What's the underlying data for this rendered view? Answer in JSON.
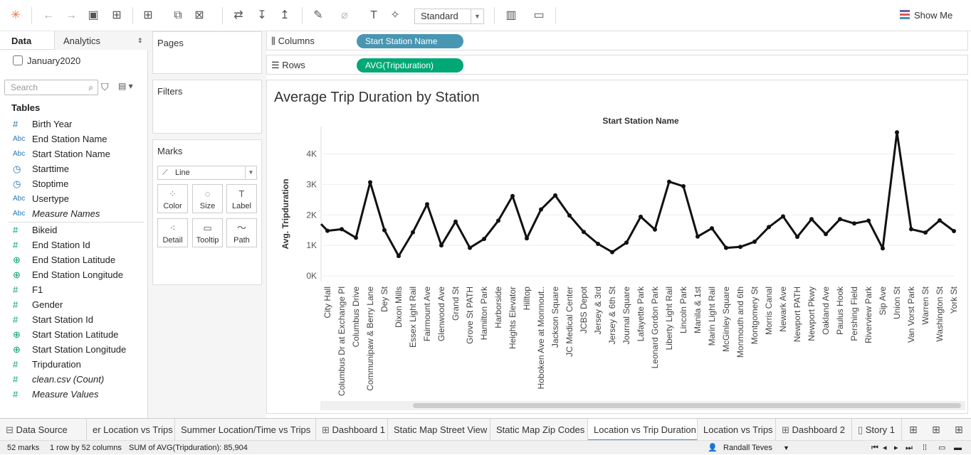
{
  "toolbar": {
    "view_mode": "Standard",
    "show_me": "Show Me"
  },
  "data_pane": {
    "tab_data": "Data",
    "tab_analytics": "Analytics",
    "datasource": "January2020",
    "search_placeholder": "Search",
    "tables_heading": "Tables",
    "fields": [
      {
        "icon": "#",
        "name": "Birth Year",
        "italic": false
      },
      {
        "icon": "Abc",
        "name": "End Station Name",
        "italic": false
      },
      {
        "icon": "Abc",
        "name": "Start Station Name",
        "italic": false
      },
      {
        "icon": "clock",
        "name": "Starttime",
        "italic": false
      },
      {
        "icon": "clock",
        "name": "Stoptime",
        "italic": false
      },
      {
        "icon": "Abc",
        "name": "Usertype",
        "italic": false
      },
      {
        "icon": "Abc",
        "name": "Measure Names",
        "italic": true
      },
      {
        "icon": "#",
        "name": "Bikeid",
        "italic": false
      },
      {
        "icon": "#",
        "name": "End Station Id",
        "italic": false
      },
      {
        "icon": "globe",
        "name": "End Station Latitude",
        "italic": false
      },
      {
        "icon": "globe",
        "name": "End Station Longitude",
        "italic": false
      },
      {
        "icon": "#",
        "name": "F1",
        "italic": false
      },
      {
        "icon": "#",
        "name": "Gender",
        "italic": false
      },
      {
        "icon": "#",
        "name": "Start Station Id",
        "italic": false
      },
      {
        "icon": "globe",
        "name": "Start Station Latitude",
        "italic": false
      },
      {
        "icon": "globe",
        "name": "Start Station Longitude",
        "italic": false
      },
      {
        "icon": "#",
        "name": "Tripduration",
        "italic": false
      },
      {
        "icon": "#",
        "name": "clean.csv (Count)",
        "italic": true
      },
      {
        "icon": "#",
        "name": "Measure Values",
        "italic": true
      }
    ]
  },
  "cards": {
    "pages": "Pages",
    "filters": "Filters",
    "marks": "Marks",
    "mark_type": "Line",
    "buttons": [
      "Color",
      "Size",
      "Label",
      "Detail",
      "Tooltip",
      "Path"
    ]
  },
  "shelves": {
    "columns_label": "Columns",
    "columns_pill": "Start Station Name",
    "rows_label": "Rows",
    "rows_pill": "AVG(Tripduration)"
  },
  "viz": {
    "title": "Average Trip Duration by Station",
    "header": "Start Station Name"
  },
  "chart_data": {
    "type": "line",
    "title": "Average Trip Duration by Station",
    "xlabel": "Start Station Name",
    "ylabel": "Avg. Tripduration",
    "y_ticks": [
      "0K",
      "1K",
      "2K",
      "3K",
      "4K"
    ],
    "ylim": [
      0,
      4900
    ],
    "grid": true,
    "categories": [
      "City Hall",
      "Columbus Dr at Exchange Pl",
      "Columbus Drive",
      "Communipaw & Berry Lane",
      "Dey St",
      "Dixon Mills",
      "Essex Light Rail",
      "Fairmount Ave",
      "Glenwood Ave",
      "Grand St",
      "Grove St PATH",
      "Hamilton Park",
      "Harborside",
      "Heights Elevator",
      "Hilltop",
      "Hoboken Ave at Monmout..",
      "Jackson Square",
      "JC Medical Center",
      "JCBS Depot",
      "Jersey & 3rd",
      "Jersey & 6th St",
      "Journal Square",
      "Lafayette Park",
      "Leonard Gordon Park",
      "Liberty Light Rail",
      "Lincoln Park",
      "Manila & 1st",
      "Marin Light Rail",
      "McGinley Square",
      "Monmouth and 6th",
      "Montgomery St",
      "Morris Canal",
      "Newark Ave",
      "Newport PATH",
      "Newport Pkwy",
      "Oakland Ave",
      "Paulus Hook",
      "Pershing Field",
      "Riverview Park",
      "Sip Ave",
      "Union St",
      "Van Vorst Park",
      "Warren St",
      "Washington St",
      "York St"
    ],
    "values": [
      1480,
      1530,
      1250,
      3070,
      1500,
      650,
      1430,
      2350,
      1000,
      1780,
      920,
      1210,
      1810,
      2620,
      1230,
      2180,
      2640,
      1980,
      1440,
      1050,
      780,
      1090,
      1940,
      1520,
      3090,
      2940,
      1290,
      1560,
      920,
      950,
      1120,
      1600,
      1950,
      1280,
      1860,
      1370,
      1860,
      1720,
      1810,
      900,
      4710,
      1530,
      1420,
      1820,
      1470
    ],
    "leading_value": 1700
  },
  "sheet_tabs": [
    {
      "label": "Data Source",
      "icon": "db"
    },
    {
      "label": "er Location vs Trips",
      "icon": ""
    },
    {
      "label": "Summer Location/Time vs Trips",
      "icon": ""
    },
    {
      "label": "Dashboard 1",
      "icon": "grid"
    },
    {
      "label": "Static Map Street View",
      "icon": ""
    },
    {
      "label": "Static Map Zip Codes",
      "icon": ""
    },
    {
      "label": "Location vs Trip Duration",
      "icon": ""
    },
    {
      "label": "Location vs Trips",
      "icon": ""
    },
    {
      "label": "Dashboard 2",
      "icon": "grid"
    },
    {
      "label": "Story 1",
      "icon": "story"
    }
  ],
  "status": {
    "marks": "52 marks",
    "dims": "1 row by 52 columns",
    "sum": "SUM of AVG(Tripduration): 85,904",
    "user": "Randall Teves"
  }
}
